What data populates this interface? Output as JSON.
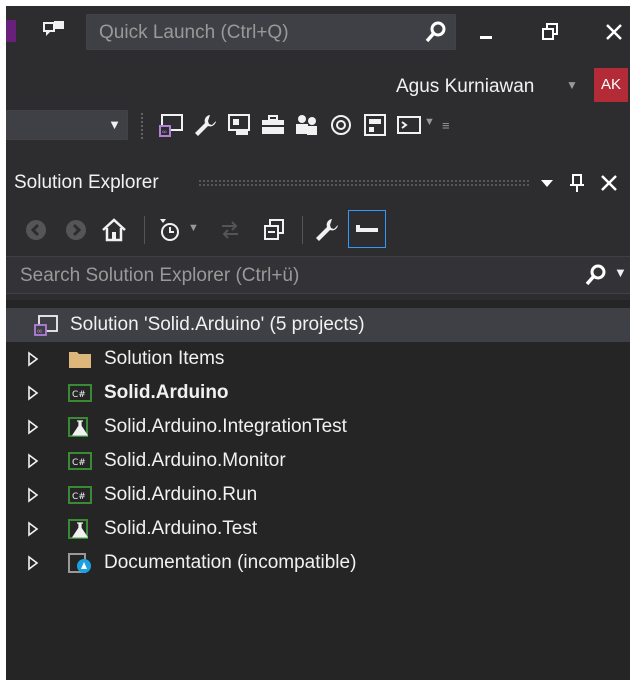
{
  "titlebar": {
    "quick_launch_placeholder": "Quick Launch (Ctrl+Q)",
    "icons": [
      "feedback-icon",
      "search-icon",
      "minimize-icon",
      "restore-icon",
      "close-icon"
    ]
  },
  "account": {
    "user_name": "Agus Kurniawan",
    "avatar_initials": "AK",
    "avatar_color": "#b32b36"
  },
  "toolbar": {
    "icons": [
      "solution-explorer-icon",
      "wrench-icon",
      "class-view-icon",
      "toolbox-icon",
      "team-explorer-icon",
      "notifications-icon",
      "properties-icon",
      "terminal-icon"
    ]
  },
  "solution_explorer": {
    "title": "Solution Explorer",
    "search_placeholder": "Search Solution Explorer (Ctrl+ü)",
    "solution_label": "Solution 'Solid.Arduino' (5 projects)",
    "items": [
      {
        "label": "Solution Items",
        "icon": "folder-icon",
        "bold": false
      },
      {
        "label": "Solid.Arduino",
        "icon": "csharp-project-icon",
        "bold": true
      },
      {
        "label": "Solid.Arduino.IntegrationTest",
        "icon": "test-project-icon",
        "bold": false
      },
      {
        "label": "Solid.Arduino.Monitor",
        "icon": "csharp-project-icon",
        "bold": false
      },
      {
        "label": "Solid.Arduino.Run",
        "icon": "csharp-project-icon",
        "bold": false
      },
      {
        "label": "Solid.Arduino.Test",
        "icon": "test-project-icon",
        "bold": false
      },
      {
        "label": "Documentation (incompatible)",
        "icon": "incompatible-project-icon",
        "bold": false
      }
    ]
  },
  "colors": {
    "background": "#2d2d30",
    "tree_background": "#252526",
    "selected_row": "#3f3f46",
    "accent_purple": "#68217a",
    "focus_border": "#3399ff"
  }
}
